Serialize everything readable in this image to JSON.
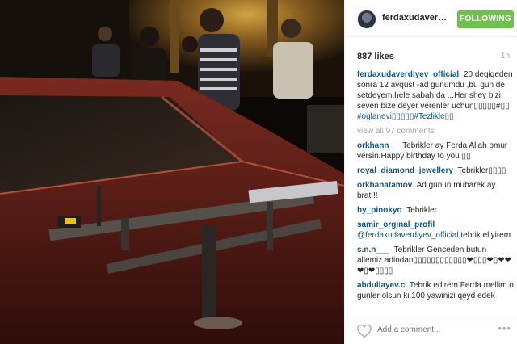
{
  "post": {
    "username": "ferdaxudaverdi...",
    "follow_label": "FOLLOWING",
    "likes": "887 likes",
    "time": "1h"
  },
  "caption": {
    "user": "ferdaxudaverdiyev_official",
    "text": "20 deqiqeden sonra 12 avqust -ad gunumdu ,bu gun de setdeyem,hele sabah da ...Her shey bizi seven bize deyer verenler uchun▯▯▯▯▯#▯▯",
    "tags": "#oglanevi▯▯▯▯▯#Tezlikle▯▯"
  },
  "view_all": "view all 97 comments",
  "comments": [
    {
      "user": "orkhann__",
      "text": "Tebrikler ay Ferda Allah omur versin.Happy birthday to you ▯▯"
    },
    {
      "user": "royal_diamond_jewellery",
      "text": "Tebrikler▯▯▯▯"
    },
    {
      "user": "orkhanatamov",
      "text": "Ad gunun mubarek ay brat!!!"
    },
    {
      "user": "by_pinokyo",
      "text": "Tebrikler"
    },
    {
      "user": "samir_orginal_profil",
      "text": "tebrik eliyirem",
      "mention": "@ferdaxudaverdiyev_official"
    },
    {
      "user": "s.n.n___",
      "text": "Tebrikler Genceden butun allemiz adindan▯▯▯▯▯▯▯▯▯▯▯▯❤▯▯▯❤▯❤❤❤▯❤▯▯▯▯"
    },
    {
      "user": "abdullayev.c",
      "text": "Tebrik edirem Ferda mellim o gunler olsun ki 100 yawinizi qeyd edek"
    }
  ],
  "add_comment_placeholder": "Add a comment...",
  "more_label": "•••",
  "icons": {
    "heart": "heart-icon",
    "more": "more-options-icon",
    "avatar": "avatar"
  },
  "colors": {
    "follow_green": "#70c050",
    "username_blue": "#125688",
    "muted_gray": "#a5a7aa"
  }
}
